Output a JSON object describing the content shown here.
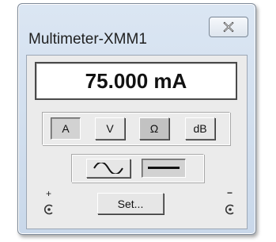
{
  "window": {
    "title": "Multimeter-XMM1"
  },
  "display": {
    "reading": "75.000 mA"
  },
  "modes": [
    {
      "label": "A",
      "selected": true
    },
    {
      "label": "V",
      "selected": false
    },
    {
      "label": "Ω",
      "selected": false
    },
    {
      "label": "dB",
      "selected": false
    }
  ],
  "waveform": {
    "ac_icon": "sine-wave-icon",
    "dc_icon": "dc-line-icon",
    "selected": "dc"
  },
  "set_button": {
    "label": "Set..."
  },
  "terminals": {
    "plus_sign": "+",
    "minus_sign": "−",
    "icon": "terminal-connector-icon"
  },
  "colors": {
    "window_frame": "#c9d8ea",
    "panel": "#ebebeb",
    "display_bg": "#ffffff"
  }
}
